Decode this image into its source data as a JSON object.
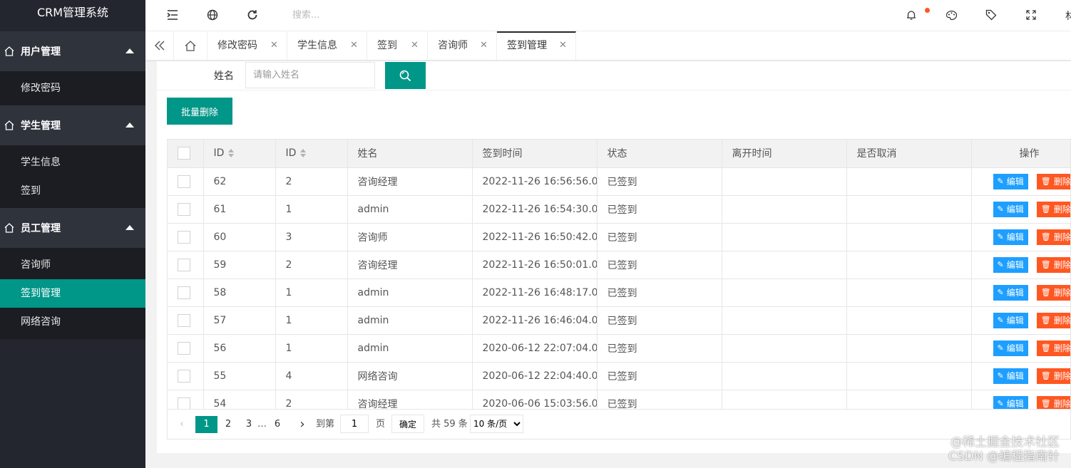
{
  "app": {
    "title": "CRM管理系统"
  },
  "sidebar": {
    "groups": [
      {
        "label": "用户管理",
        "items": [
          {
            "label": "修改密码"
          }
        ]
      },
      {
        "label": "学生管理",
        "items": [
          {
            "label": "学生信息"
          },
          {
            "label": "签到"
          }
        ]
      },
      {
        "label": "员工管理",
        "items": [
          {
            "label": "咨询师"
          },
          {
            "label": "签到管理",
            "active": true
          },
          {
            "label": "网络咨询"
          }
        ]
      }
    ]
  },
  "topbar": {
    "search_placeholder": "搜索...",
    "user_initial": "林"
  },
  "tabs": [
    {
      "label": "修改密码"
    },
    {
      "label": "学生信息"
    },
    {
      "label": "签到"
    },
    {
      "label": "咨询师"
    },
    {
      "label": "签到管理",
      "active": true
    }
  ],
  "tab_close_glyph": "✕",
  "filter": {
    "label": "姓名",
    "placeholder": "请输入姓名"
  },
  "batch_delete_label": "批量删除",
  "table": {
    "headers": [
      "ID",
      "ID",
      "姓名",
      "签到时间",
      "状态",
      "离开时间",
      "是否取消",
      "操作"
    ],
    "edit_label": "编辑",
    "delete_label": "删除",
    "rows": [
      {
        "id": "62",
        "uid": "2",
        "name": "咨询经理",
        "time": "2022-11-26 16:56:56.0",
        "status": "已签到",
        "leave": "",
        "cancel": ""
      },
      {
        "id": "61",
        "uid": "1",
        "name": "admin",
        "time": "2022-11-26 16:54:30.0",
        "status": "已签到",
        "leave": "",
        "cancel": ""
      },
      {
        "id": "60",
        "uid": "3",
        "name": "咨询师",
        "time": "2022-11-26 16:50:42.0",
        "status": "已签到",
        "leave": "",
        "cancel": ""
      },
      {
        "id": "59",
        "uid": "2",
        "name": "咨询经理",
        "time": "2022-11-26 16:50:01.0",
        "status": "已签到",
        "leave": "",
        "cancel": ""
      },
      {
        "id": "58",
        "uid": "1",
        "name": "admin",
        "time": "2022-11-26 16:48:17.0",
        "status": "已签到",
        "leave": "",
        "cancel": ""
      },
      {
        "id": "57",
        "uid": "1",
        "name": "admin",
        "time": "2022-11-26 16:46:04.0",
        "status": "已签到",
        "leave": "",
        "cancel": ""
      },
      {
        "id": "56",
        "uid": "1",
        "name": "admin",
        "time": "2020-06-12 22:07:04.0",
        "status": "已签到",
        "leave": "",
        "cancel": ""
      },
      {
        "id": "55",
        "uid": "4",
        "name": "网络咨询",
        "time": "2020-06-12 22:04:40.0",
        "status": "已签到",
        "leave": "",
        "cancel": ""
      },
      {
        "id": "54",
        "uid": "2",
        "name": "咨询经理",
        "time": "2020-06-06 15:03:56.0",
        "status": "已签到",
        "leave": "",
        "cancel": ""
      }
    ]
  },
  "pager": {
    "prev": "‹",
    "next": "›",
    "pages": [
      "1",
      "2",
      "3"
    ],
    "ellipsis": "…",
    "last": "6",
    "goto_label": "到第",
    "goto_value": "1",
    "page_unit": "页",
    "ok_label": "确定",
    "total": "共 59 条",
    "page_size": "10 条/页"
  },
  "watermark": {
    "line1": "@稀土掘金技术社区",
    "line2": "CSDN @编程指南针"
  }
}
